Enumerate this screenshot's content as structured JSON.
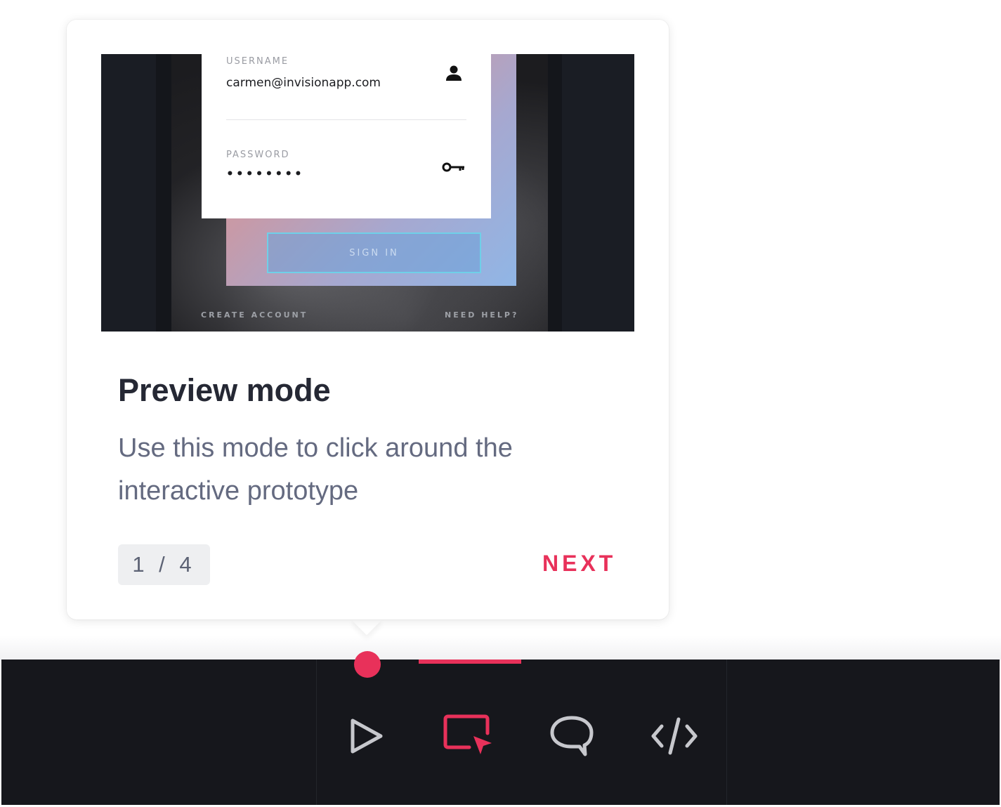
{
  "onboarding": {
    "preview": {
      "username_label": "USERNAME",
      "username_value": "carmen@invisionapp.com",
      "password_label": "PASSWORD",
      "password_value": "••••••••",
      "signin_label": "SIGN IN",
      "create_account_label": "CREATE ACCOUNT",
      "need_help_label": "NEED HELP?"
    },
    "title": "Preview mode",
    "description": "Use this mode to click around the interactive prototype",
    "pager": "1 / 4",
    "next_label": "NEXT",
    "step_current": 1,
    "step_total": 4
  },
  "toolbar": {
    "tools": [
      {
        "icon": "play-icon",
        "active": false
      },
      {
        "icon": "preview-cursor-icon",
        "active": true
      },
      {
        "icon": "comment-icon",
        "active": false
      },
      {
        "icon": "code-icon",
        "active": false
      }
    ]
  },
  "colors": {
    "accent": "#e8315a",
    "toolbar_bg": "#16171c",
    "icon_inactive": "#c7c8cd",
    "title": "#252834",
    "body_text": "#646a80"
  }
}
